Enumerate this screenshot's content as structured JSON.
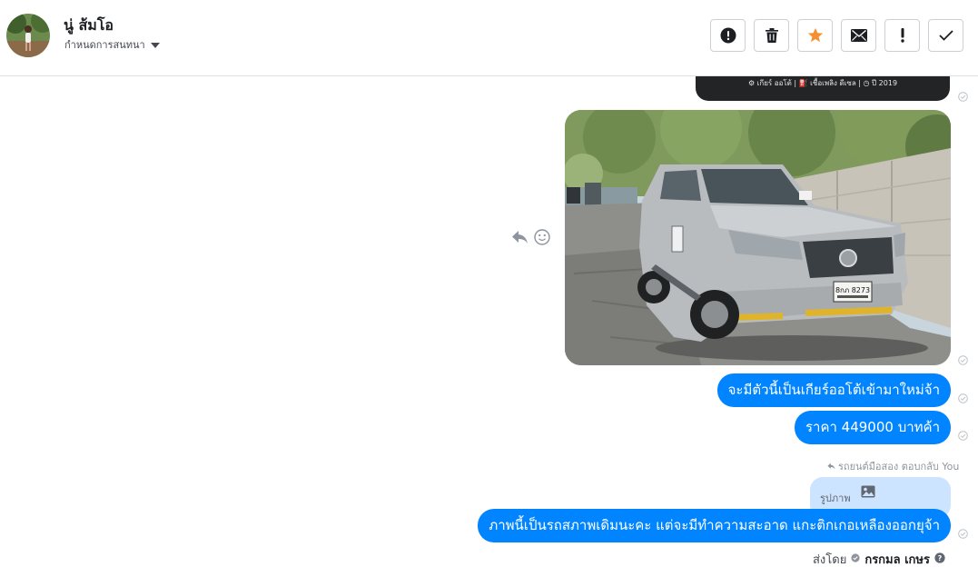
{
  "header": {
    "contact_name": "นู่ ส้มโอ",
    "assign_label": "กำหนดการสนทนา",
    "actions": [
      {
        "name": "mark-spam-button",
        "icon": "alert-circle-icon"
      },
      {
        "name": "delete-button",
        "icon": "trash-icon"
      },
      {
        "name": "star-button",
        "icon": "star-icon",
        "color": "#f5902e"
      },
      {
        "name": "mark-unread-button",
        "icon": "envelope-icon"
      },
      {
        "name": "follow-up-button",
        "icon": "exclamation-icon"
      },
      {
        "name": "mark-done-button",
        "icon": "check-icon"
      }
    ]
  },
  "conversation": {
    "previous_card_meta": "⚙ เกียร์ ออโต้ | ⛽ เชื้อเพลิง ดีเซล | ◷ ปี 2019",
    "messages": [
      "จะมีตัวนี้เป็นเกียร์ออโต้เข้ามาใหม่จ้า",
      "ราคา 449000 บาทค้า",
      "ภาพนี้เป็นรถสภาพเดิมนะคะ  แต่จะมีทำความสะอาด แกะติกเกอเหลืองออกยุจ้า"
    ],
    "reply_label": "รถยนต์มือสอง ตอบกลับ You",
    "quoted_text": "รูปภาพ",
    "sent_by_label": "ส่งโดย",
    "sent_by_agent": "กรกมล เกษร",
    "plate_text": "8กภ 8273"
  },
  "colors": {
    "bubble": "#0084ff",
    "quote_bubble": "#cce4ff",
    "star": "#f5902e"
  }
}
